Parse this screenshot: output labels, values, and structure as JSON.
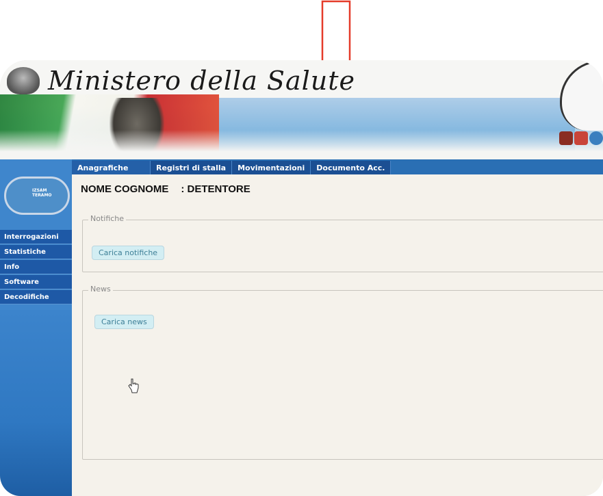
{
  "header": {
    "title": "Ministero della Salute"
  },
  "nav": {
    "items": [
      {
        "label": "Anagrafiche"
      },
      {
        "label": "Registri di stalla"
      },
      {
        "label": "Movimentazioni"
      },
      {
        "label": "Documento Acc."
      }
    ]
  },
  "logo": {
    "text": "IZSAM TERAMO"
  },
  "sidebar": {
    "items": [
      {
        "label": "Interrogazioni"
      },
      {
        "label": "Statistiche"
      },
      {
        "label": "Info"
      },
      {
        "label": "Software"
      },
      {
        "label": "Decodifiche"
      }
    ]
  },
  "main": {
    "user_name": "NOME COGNOME",
    "user_role": ": DETENTORE",
    "notifiche": {
      "legend": "Notifiche",
      "button_label": "Carica notifiche"
    },
    "news": {
      "legend": "News",
      "button_label": "Carica news"
    }
  },
  "colors": {
    "annotation_arrow": "#e53b2a",
    "nav_bar": "#1b4f93",
    "sidebar": "#3f86cc"
  },
  "icons": [
    "emblem-icon",
    "house-icon",
    "user-icon",
    "pointer-hand-icon",
    "down-arrow-icon"
  ]
}
